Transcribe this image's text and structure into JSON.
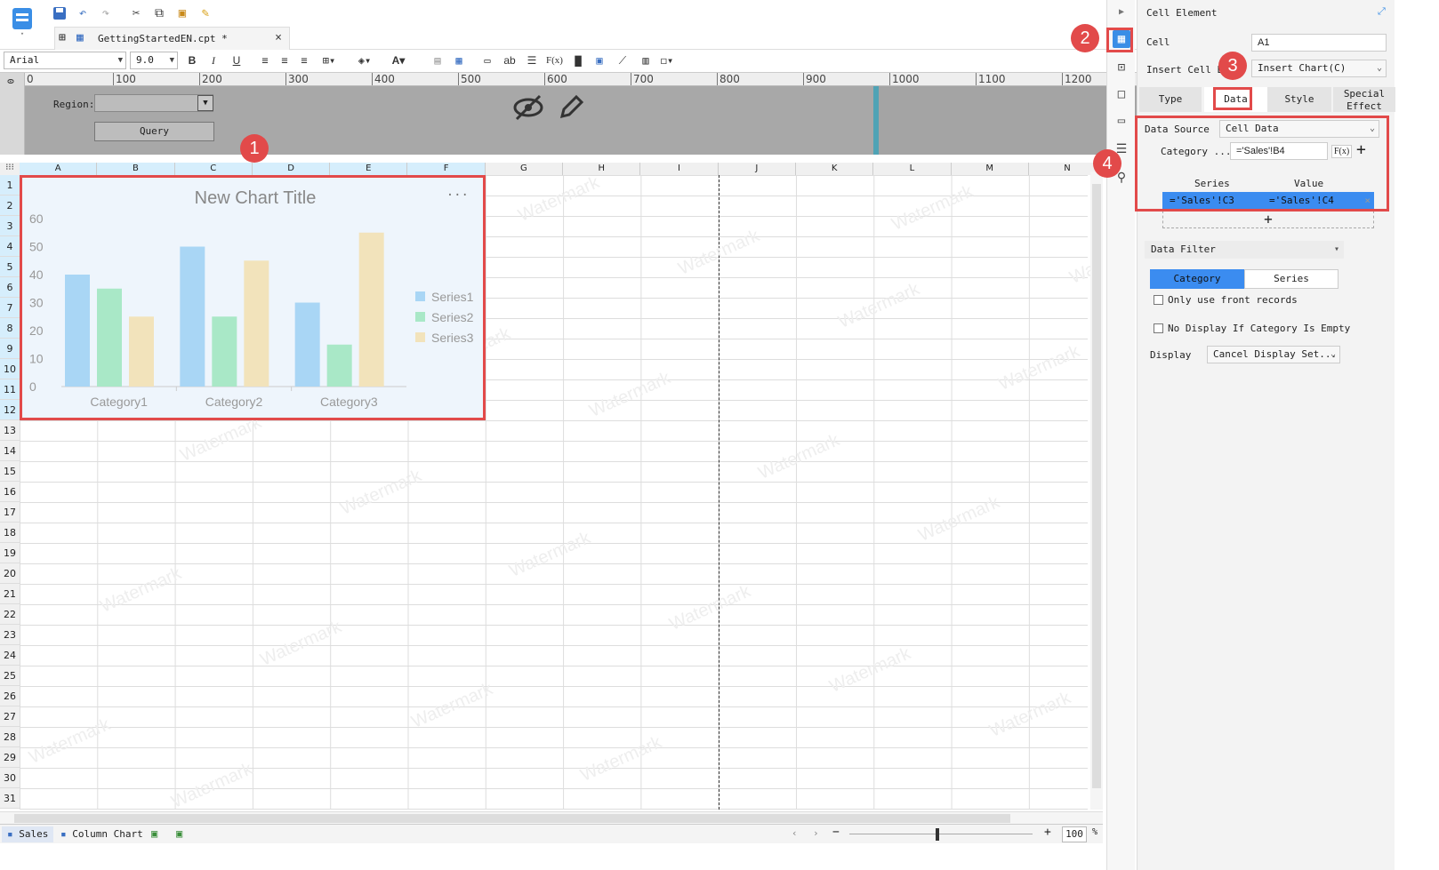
{
  "file_tab": {
    "name": "GettingStartedEN.cpt *",
    "close": "×"
  },
  "format_bar": {
    "font": "Arial",
    "size": "9.0",
    "bold": "B",
    "italic": "I",
    "underline": "U",
    "ab": "ab",
    "fx": "F(x)"
  },
  "ruler": {
    "zero": "0",
    "ticks": [
      "100",
      "200",
      "300",
      "400",
      "500",
      "600",
      "700",
      "800",
      "900",
      "1000",
      "1100",
      "1200"
    ]
  },
  "param_pane": {
    "region_label": "Region:",
    "query_button": "Query"
  },
  "columns": [
    "A",
    "B",
    "C",
    "D",
    "E",
    "F",
    "G",
    "H",
    "I",
    "J",
    "K",
    "L",
    "M",
    "N"
  ],
  "rows": [
    "1",
    "2",
    "3",
    "4",
    "5",
    "6",
    "7",
    "8",
    "9",
    "10",
    "11",
    "12",
    "13",
    "14",
    "15",
    "16",
    "17",
    "18",
    "19",
    "20",
    "21",
    "22",
    "23",
    "24",
    "25",
    "26",
    "27",
    "28",
    "29",
    "30",
    "31"
  ],
  "watermark": "Watermark",
  "chart": {
    "menu": "···"
  },
  "chart_data": {
    "type": "bar",
    "title": "New Chart Title",
    "categories": [
      "Category1",
      "Category2",
      "Category3"
    ],
    "series": [
      {
        "name": "Series1",
        "values": [
          40,
          50,
          30
        ],
        "color": "#a9d6f5"
      },
      {
        "name": "Series2",
        "values": [
          35,
          25,
          15
        ],
        "color": "#a9e8c7"
      },
      {
        "name": "Series3",
        "values": [
          25,
          45,
          55
        ],
        "color": "#f2e3bb"
      }
    ],
    "ylim": [
      0,
      60
    ],
    "yticks": [
      0,
      10,
      20,
      30,
      40,
      50,
      60
    ],
    "legend": "right"
  },
  "sheets": [
    "Sales",
    "Column Chart"
  ],
  "status": {
    "zoom": "100",
    "percent": "%"
  },
  "panel": {
    "title": "Cell Element",
    "cell_label": "Cell",
    "cell_value": "A1",
    "insert_label": "Insert Cell Ele",
    "insert_value": "Insert Chart(C)",
    "tabs": [
      "Type",
      "Data",
      "Style",
      "Special Effect"
    ],
    "data_source_label": "Data Source",
    "data_source_value": "Cell Data",
    "category_label": "Category ...",
    "category_value": "='Sales'!B4",
    "fx": "F(x)",
    "plus": "+",
    "series_header": "Series",
    "value_header": "Value",
    "series_value": "='Sales'!C3",
    "value_value": "='Sales'!C4",
    "data_filter": "Data Filter",
    "filter_tabs": [
      "Category",
      "Series"
    ],
    "only_front": "Only use front records",
    "no_display": "No Display If Category Is Empty",
    "display_label": "Display",
    "display_value": "Cancel Display Set..."
  },
  "badges": [
    "1",
    "2",
    "3",
    "4"
  ],
  "colors": {
    "annotation": "#e24a4a",
    "selected": "#3b8cf0"
  }
}
